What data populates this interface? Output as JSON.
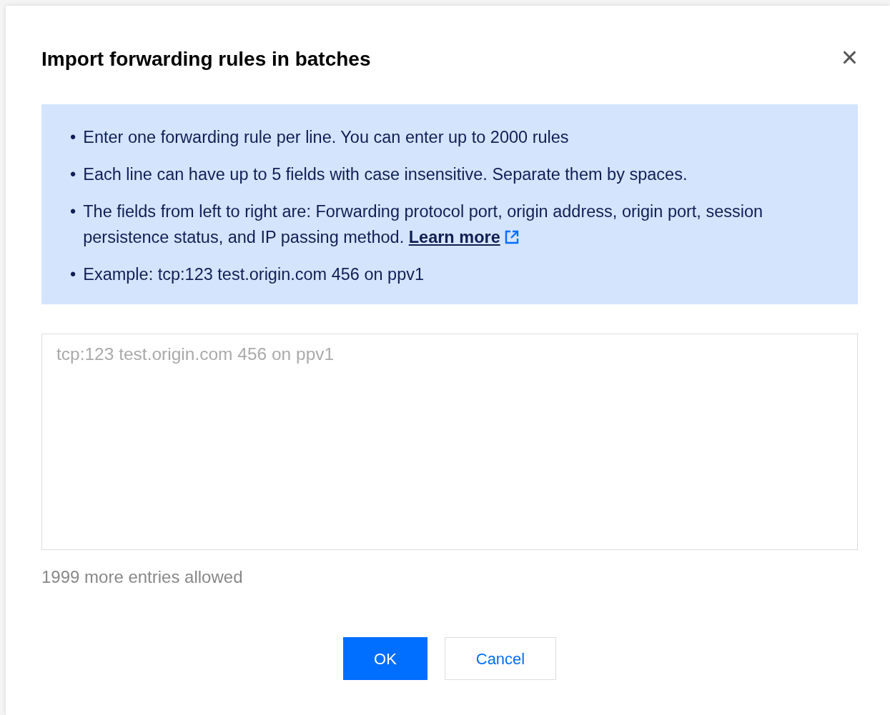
{
  "dialog": {
    "title": "Import forwarding rules in batches",
    "close": "×"
  },
  "notice": {
    "items": [
      {
        "bullet": "•",
        "text": "Enter one forwarding rule per line. You can enter up to 2000 rules"
      },
      {
        "bullet": "•",
        "text": "Each line can have up to 5 fields with case insensitive. Separate them by spaces."
      },
      {
        "bullet": "•",
        "text": "The fields from left to right are: Forwarding protocol port, origin address, origin port, session persistence status, and IP passing method.",
        "link": "Learn more"
      },
      {
        "bullet": "•",
        "text": "Example: tcp:123 test.origin.com 456 on ppv1"
      }
    ]
  },
  "input": {
    "placeholder": "tcp:123 test.origin.com 456 on ppv1"
  },
  "hint": "1999 more entries allowed",
  "buttons": [
    {
      "label": "OK",
      "kind": "primary"
    },
    {
      "label": "Cancel",
      "kind": "default"
    }
  ]
}
